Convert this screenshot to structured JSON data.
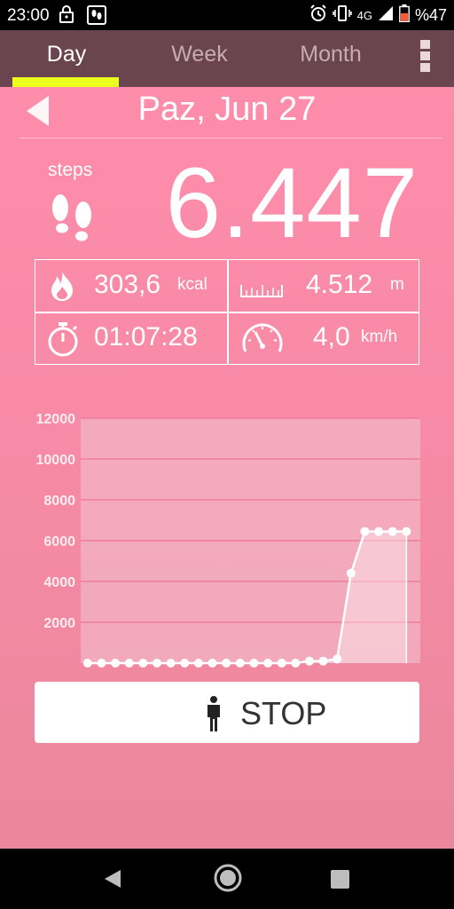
{
  "status_bar": {
    "time": "23:00",
    "network": "4G",
    "battery": "%47",
    "icons": [
      "lock-icon",
      "app-notification-icon",
      "alarm-icon",
      "vibrate-icon",
      "signal-icon",
      "battery-icon"
    ]
  },
  "tabs": [
    {
      "label": "Day",
      "active": true
    },
    {
      "label": "Week",
      "active": false
    },
    {
      "label": "Month",
      "active": false
    }
  ],
  "header": {
    "date": "Paz, Jun 27"
  },
  "steps": {
    "label": "steps",
    "value": "6.447"
  },
  "stats": {
    "calories": {
      "value": "303,6",
      "unit": "kcal",
      "icon": "flame-icon"
    },
    "distance": {
      "value": "4.512",
      "unit": "m",
      "icon": "ruler-icon"
    },
    "duration": {
      "value": "01:07:28",
      "unit": "",
      "icon": "stopwatch-icon"
    },
    "speed": {
      "value": "4,0",
      "unit": "km/h",
      "icon": "speedometer-icon"
    }
  },
  "chart_data": {
    "type": "area",
    "x": [
      0,
      1,
      2,
      3,
      4,
      5,
      6,
      7,
      8,
      9,
      10,
      11,
      12,
      13,
      14,
      15,
      16,
      17,
      18,
      19,
      20,
      21,
      22,
      23
    ],
    "values": [
      0,
      0,
      0,
      0,
      0,
      0,
      0,
      0,
      0,
      0,
      0,
      0,
      0,
      0,
      0,
      0,
      100,
      100,
      200,
      4400,
      6447,
      6447,
      6447,
      6447
    ],
    "x_ticks": [
      "2",
      "4",
      "6",
      "8",
      "10",
      "12",
      "14",
      "16",
      "18",
      "20",
      "22",
      "24"
    ],
    "y_ticks": [
      "2000",
      "4000",
      "6000",
      "8000",
      "10000",
      "12000"
    ],
    "xlim": [
      -0.5,
      24
    ],
    "ylim": [
      0,
      12000
    ],
    "grid": true,
    "colors": {
      "line": "#ffffff",
      "plot_bg": "#f3b4c4",
      "gridline": "#f07d9a"
    }
  },
  "stop_button": {
    "label": "STOP",
    "icon": "person-icon"
  },
  "colors": {
    "accent": "#eaff1e",
    "tabbar": "#6a454f",
    "background": "#ff8dac"
  }
}
